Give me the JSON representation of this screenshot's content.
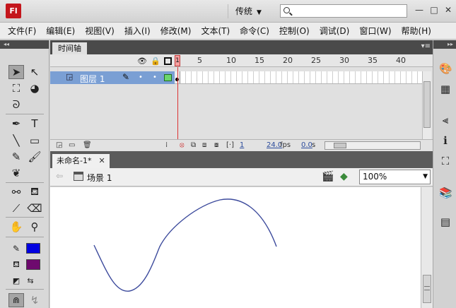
{
  "titlebar": {
    "logo": "Fl",
    "workspace": "传统",
    "search_value": "",
    "minimize": "—",
    "restore": "□",
    "close": "✕"
  },
  "menu": [
    "文件(F)",
    "编辑(E)",
    "视图(V)",
    "插入(I)",
    "修改(M)",
    "文本(T)",
    "命令(C)",
    "控制(O)",
    "调试(D)",
    "窗口(W)",
    "帮助(H)"
  ],
  "timeline": {
    "tab_label": "时间轴",
    "frame_numbers": [
      "1",
      "5",
      "10",
      "15",
      "20",
      "25",
      "30",
      "35",
      "40"
    ],
    "current_frame": "1",
    "layer_name": "图层 1",
    "footer_frame": "1",
    "fps": "24.0",
    "fps_unit": "fps",
    "time": "0.0",
    "time_unit": "s"
  },
  "document": {
    "tab_label": "未命名-1*",
    "close": "✕",
    "scene_label": "场景 1",
    "zoom": "100%"
  },
  "colors": {
    "stroke_color": "#0000e0",
    "fill_color": "#6e0a6e",
    "stroke_on_stage": "#3c4a9c",
    "layer_highlight": "#7a9fd4"
  }
}
